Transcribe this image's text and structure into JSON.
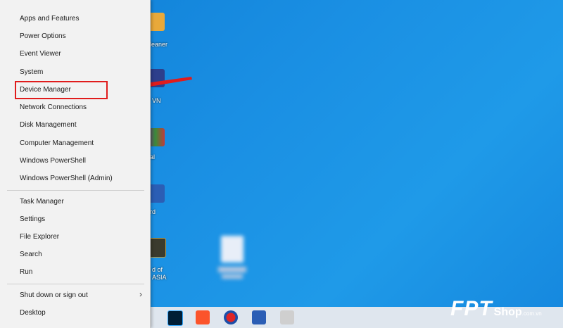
{
  "menu": {
    "group1": [
      "Apps and Features",
      "Power Options",
      "Event Viewer",
      "System",
      "Device Manager",
      "Network Connections",
      "Disk Management",
      "Computer Management",
      "Windows PowerShell",
      "Windows PowerShell (Admin)"
    ],
    "group2": [
      "Task Manager",
      "Settings",
      "File Explorer",
      "Search",
      "Run"
    ],
    "group3": [
      "Shut down or sign out",
      "Desktop"
    ]
  },
  "desktop_labels": {
    "cleaner": "leaner",
    "vpn": "VN",
    "al": "al",
    "rd": "rd",
    "of": "d of",
    "asia": "ASIA"
  },
  "watermark": {
    "brand": "FPT",
    "shop": "Shop",
    "domain": ".com.vn"
  },
  "colors": {
    "highlight": "#e01c1c",
    "desktop": "#1a8fe3",
    "menu_bg": "#f2f2f2"
  }
}
